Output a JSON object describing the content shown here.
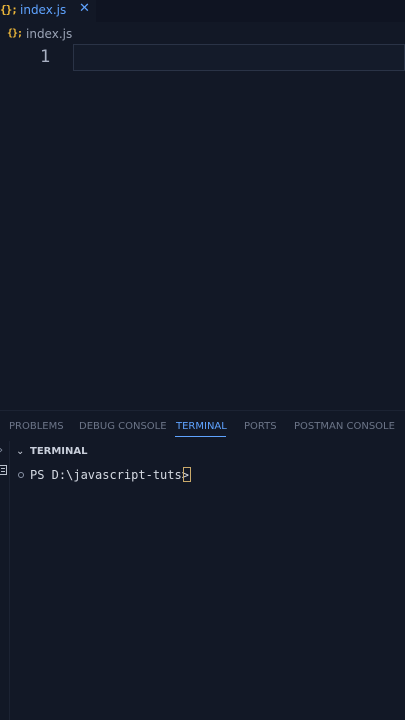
{
  "tab": {
    "icon": "{};",
    "label": "index.js",
    "close": "✕"
  },
  "breadcrumb": {
    "icon": "{};",
    "label": "index.js"
  },
  "editor": {
    "line_number": "1"
  },
  "panel": {
    "tabs": [
      {
        "label": "PROBLEMS"
      },
      {
        "label": "DEBUG CONSOLE"
      },
      {
        "label": "TERMINAL"
      },
      {
        "label": "PORTS"
      },
      {
        "label": "POSTMAN CONSOLE"
      }
    ],
    "active_tab": "TERMINAL",
    "terminal_title": "TERMINAL",
    "prompt": "PS D:\\javascript-tuts>"
  },
  "icons": {
    "file": "js-file-icon",
    "close": "close-icon",
    "chevron": "chevron-down-icon",
    "side_chevron": "chevron-right-icon",
    "list": "list-icon",
    "status": "circle-icon"
  },
  "colors": {
    "background": "#121826",
    "accent": "#5fa3ff",
    "js_icon": "#f0b93a",
    "cursor": "#c9a96a"
  }
}
